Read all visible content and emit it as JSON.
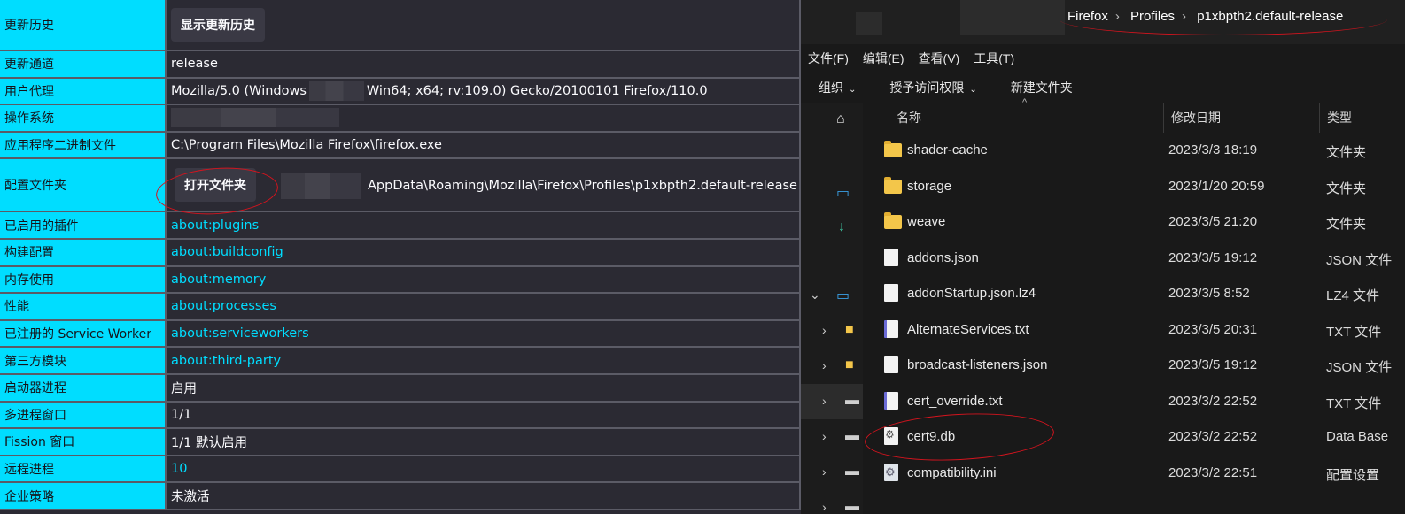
{
  "support_table": {
    "rows": [
      {
        "key": "更新历史",
        "button": "显示更新历史"
      },
      {
        "key": "更新通道",
        "value": "release"
      },
      {
        "key": "用户代理",
        "value_a": "Mozilla/5.0 (Windows",
        "value_b": "Win64; x64; rv:109.0) Gecko/20100101 Firefox/110.0"
      },
      {
        "key": "操作系统"
      },
      {
        "key": "应用程序二进制文件",
        "value": "C:\\Program Files\\Mozilla Firefox\\firefox.exe"
      },
      {
        "key": "配置文件夹",
        "button": "打开文件夹",
        "value": "AppData\\Roaming\\Mozilla\\Firefox\\Profiles\\p1xbpth2.default-release"
      },
      {
        "key": "已启用的插件",
        "link": "about:plugins"
      },
      {
        "key": "构建配置",
        "link": "about:buildconfig"
      },
      {
        "key": "内存使用",
        "link": "about:memory"
      },
      {
        "key": "性能",
        "link": "about:processes"
      },
      {
        "key": "已注册的 Service Worker",
        "link": "about:serviceworkers"
      },
      {
        "key": "第三方模块",
        "link": "about:third-party"
      },
      {
        "key": "启动器进程",
        "value": "启用"
      },
      {
        "key": "多进程窗口",
        "value": "1/1"
      },
      {
        "key": "Fission 窗口",
        "value": "1/1 默认启用"
      },
      {
        "key": "远程进程",
        "link": "10"
      },
      {
        "key": "企业策略",
        "value": "未激活"
      }
    ]
  },
  "explorer": {
    "breadcrumb": [
      "Firefox",
      "Profiles",
      "p1xbpth2.default-release"
    ],
    "menu": [
      "文件(F)",
      "编辑(E)",
      "查看(V)",
      "工具(T)"
    ],
    "commands": [
      "组织",
      "授予访问权限",
      "新建文件夹"
    ],
    "columns": {
      "name": "名称",
      "date": "修改日期",
      "type": "类型"
    },
    "files": [
      {
        "name": "shader-cache",
        "date": "2023/3/3 18:19",
        "type": "文件夹",
        "icon": "folder-icon"
      },
      {
        "name": "storage",
        "date": "2023/1/20 20:59",
        "type": "文件夹",
        "icon": "folder-icon"
      },
      {
        "name": "weave",
        "date": "2023/3/5 21:20",
        "type": "文件夹",
        "icon": "folder-icon"
      },
      {
        "name": "addons.json",
        "date": "2023/3/5 19:12",
        "type": "JSON 文件",
        "icon": "file-icon"
      },
      {
        "name": "addonStartup.json.lz4",
        "date": "2023/3/5 8:52",
        "type": "LZ4 文件",
        "icon": "file-icon"
      },
      {
        "name": "AlternateServices.txt",
        "date": "2023/3/5 20:31",
        "type": "TXT 文件",
        "icon": "text-file-icon"
      },
      {
        "name": "broadcast-listeners.json",
        "date": "2023/3/5 19:12",
        "type": "JSON 文件",
        "icon": "file-icon"
      },
      {
        "name": "cert_override.txt",
        "date": "2023/3/2 22:52",
        "type": "TXT 文件",
        "icon": "text-file-icon"
      },
      {
        "name": "cert9.db",
        "date": "2023/3/2 22:52",
        "type": "Data Base",
        "icon": "database-file-icon"
      },
      {
        "name": "compatibility.ini",
        "date": "2023/3/2 22:51",
        "type": "配置设置",
        "icon": "settings-file-icon"
      }
    ]
  }
}
